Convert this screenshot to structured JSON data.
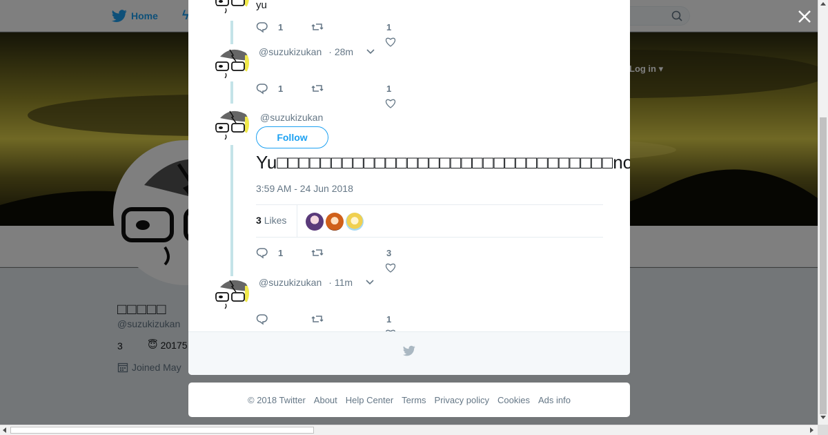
{
  "nav": {
    "home_label": "Home",
    "login_label": "Log in"
  },
  "profile": {
    "name": "□□□□□",
    "handle": "@suzukizukan",
    "stat": "3",
    "bio_emoji": "😇",
    "bio_text": "20175",
    "joined": "Joined May"
  },
  "thread": {
    "first": {
      "text": "yu",
      "reply_count": "1",
      "like_count": "1"
    },
    "second": {
      "handle": "@suzukizukan",
      "time": "· 28m",
      "reply_count": "1",
      "like_count": "1"
    },
    "main": {
      "handle": "@suzukizukan",
      "follow_label": "Follow",
      "text": "Yu□□□□□□□□□□□□□□□□□□□□□□□□□□□□□□□note□□□□□□□□□□□□□□□□□",
      "date": "3:59 AM - 24 Jun 2018",
      "likes_number": "3",
      "likes_label": "Likes",
      "reply_count": "1",
      "like_count": "3"
    },
    "last": {
      "handle": "@suzukizukan",
      "time": "· 11m",
      "like_count": "1"
    }
  },
  "footer": {
    "copyright": "© 2018 Twitter",
    "links": [
      "About",
      "Help Center",
      "Terms",
      "Privacy policy",
      "Cookies",
      "Ads info"
    ]
  },
  "colors": {
    "accent": "#1da1f2",
    "thread_line": "#c4e3e8",
    "muted": "#657786"
  },
  "icons": [
    "twitter-bird-icon",
    "search-icon",
    "close-icon",
    "reply-icon",
    "retweet-icon",
    "heart-icon",
    "chevron-down-icon",
    "calendar-icon"
  ]
}
